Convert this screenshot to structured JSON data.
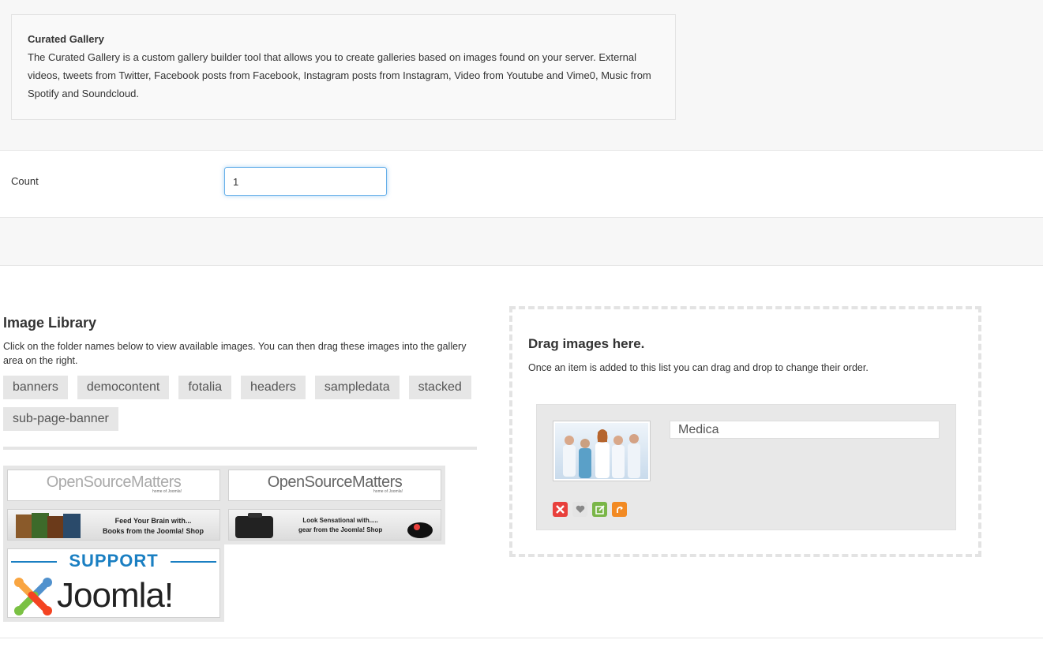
{
  "description": {
    "title": "Curated Gallery",
    "text": "The Curated Gallery is a custom gallery builder tool that allows you to create galleries based on images found on your server. External videos, tweets from Twitter, Facebook posts from Facebook, Instagram posts from Instagram, Video from Youtube and Vime0, Music from Spotify and Soundcloud."
  },
  "count": {
    "label": "Count",
    "value": "1"
  },
  "library": {
    "title": "Image Library",
    "help": "Click on the folder names below to view available images. You can then drag these images into the gallery area on the right.",
    "folders": [
      "banners",
      "democontent",
      "fotalia",
      "headers",
      "sampledata",
      "stacked",
      "sub-page-banner"
    ],
    "thumbnails": {
      "osm": "OpenSourceMatters",
      "osm_sub": "home of Joomla!",
      "shop1_line1": "Feed Your Brain with...",
      "shop1_line2": "Books from the Joomla! Shop",
      "shop2_line1": "Look Sensational with.....",
      "shop2_line2": "gear from the Joomla! Shop",
      "support": "SUPPORT",
      "joomla": "Joomla!"
    }
  },
  "dropzone": {
    "title": "Drag images here.",
    "help": "Once an item is added to this list you can drag and drop to change their order.",
    "item": {
      "name": "Medica"
    }
  },
  "colors": {
    "focus_border": "#66afe9",
    "delete": "#e8403c",
    "edit": "#7ab648",
    "rotate": "#f28a23",
    "support_blue": "#1a7fc2"
  }
}
